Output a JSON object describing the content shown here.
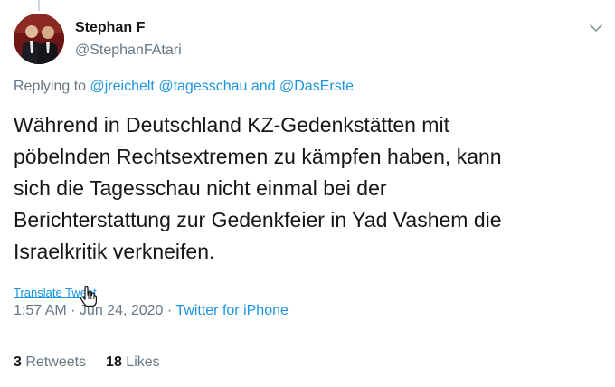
{
  "author": {
    "display_name": "Stephan F",
    "handle": "@StephanFAtari"
  },
  "reply": {
    "prefix": "Replying to ",
    "mentions": [
      "@jreichelt",
      "@tagesschau",
      "@DasErste"
    ],
    "conjunction": " and "
  },
  "tweet": {
    "text": "Während in Deutschland KZ-Gedenkstätten mit\npöbelnden Rechtsextremen zu kämpfen haben, kann\nsich die Tagesschau nicht einmal bei der\nBerichterstattung zur Gedenkfeier in Yad Vashem die\nIsraelkritik verkneifen.",
    "translate_label": "Translate Tweet",
    "time": "1:57 AM",
    "separator": " · ",
    "date": "Jun 24, 2020",
    "source": "Twitter for iPhone"
  },
  "stats": {
    "retweets_count": "3",
    "retweets_label": " Retweets",
    "likes_count": "18",
    "likes_label": " Likes"
  },
  "icons": {
    "caret": "chevron-down-icon",
    "cursor": "hand-pointer-icon"
  },
  "colors": {
    "link": "#1b95e0",
    "muted": "#657786",
    "text": "#14171a",
    "divider": "#e6ecf0"
  }
}
